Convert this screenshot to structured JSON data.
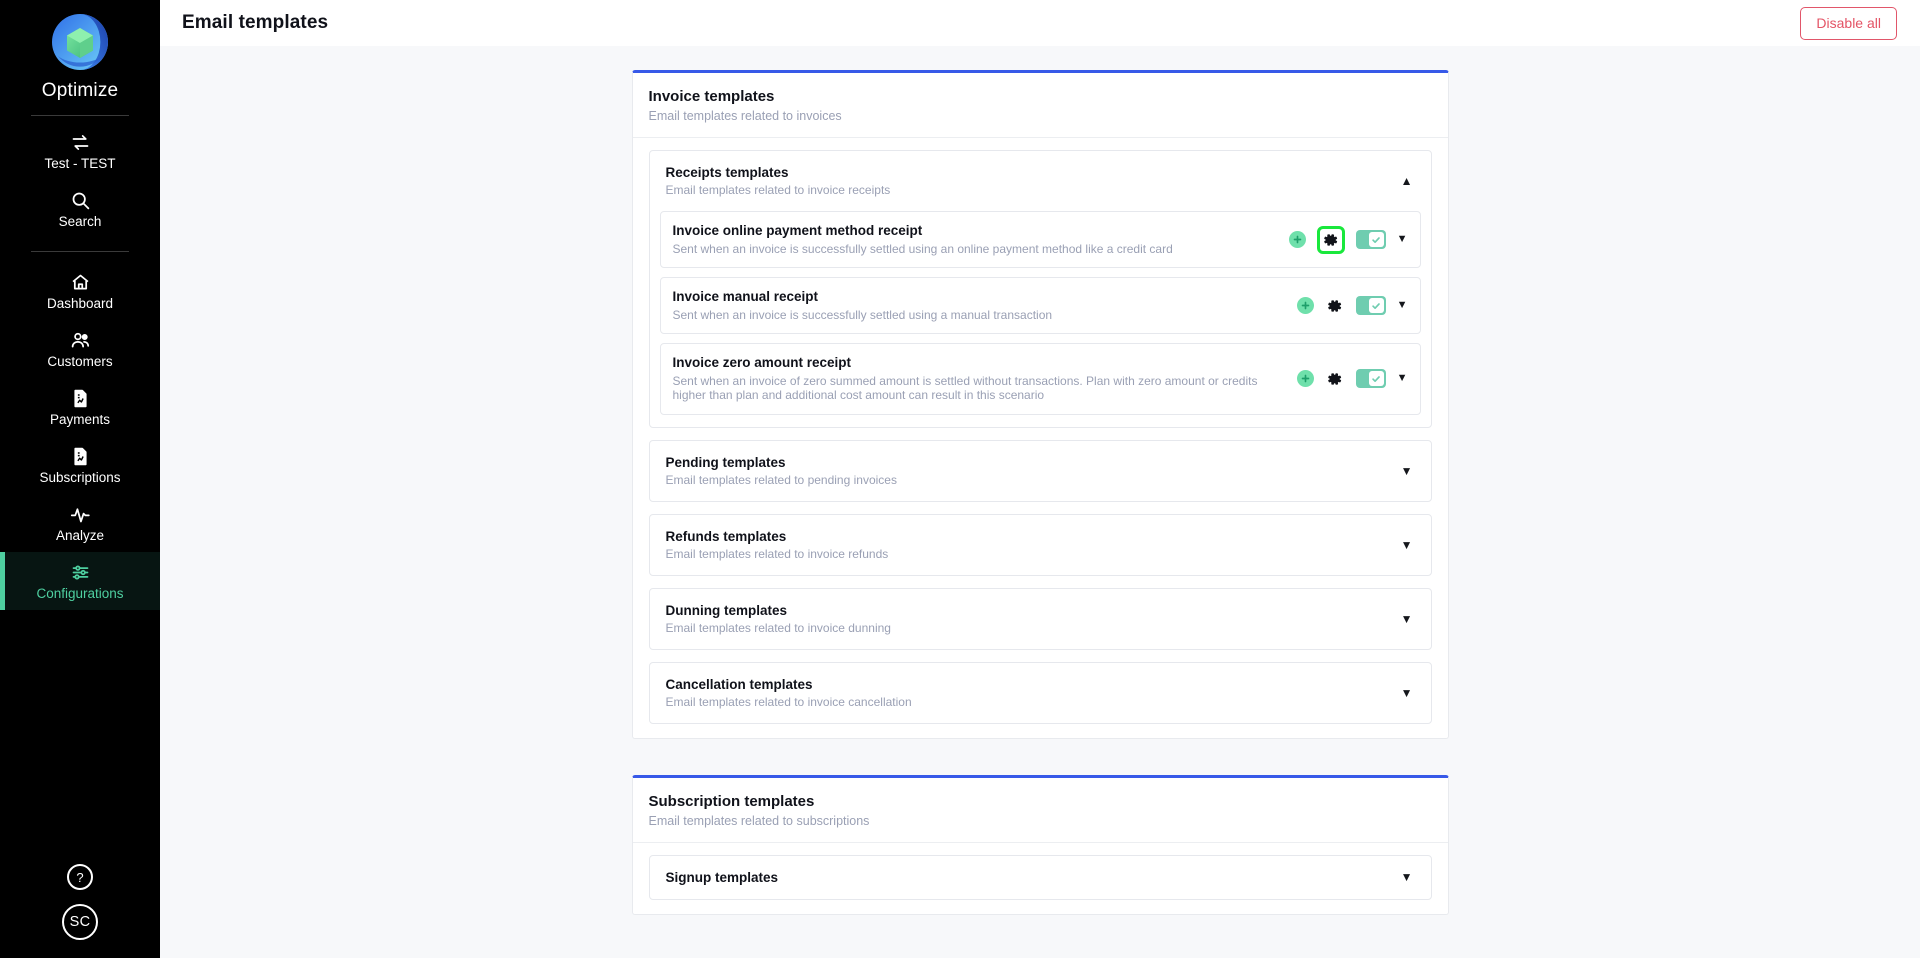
{
  "colors": {
    "sidebar_bg": "#000000",
    "accent_green": "#4ecfa0",
    "card_top_border": "#3759e8",
    "danger": "#e45466",
    "highlight_green": "#19e83c",
    "toggle_on": "#6fcdb0",
    "plus_green": "#6fe0ab"
  },
  "sidebar": {
    "brand": "Optimize",
    "logo_icon": "optimize-logo-icon",
    "top_items": [
      {
        "label": "Test - TEST",
        "icon": "switch-arrows-icon",
        "name": "tenant-switcher",
        "active": false
      },
      {
        "label": "Search",
        "icon": "search-icon",
        "name": "search",
        "active": false
      }
    ],
    "main_items": [
      {
        "label": "Dashboard",
        "icon": "home-icon",
        "name": "dashboard",
        "active": false
      },
      {
        "label": "Customers",
        "icon": "users-icon",
        "name": "customers",
        "active": false
      },
      {
        "label": "Payments",
        "icon": "document-chart-icon",
        "name": "payments",
        "active": false
      },
      {
        "label": "Subscriptions",
        "icon": "document-chart-icon",
        "name": "subscriptions",
        "active": false
      },
      {
        "label": "Analyze",
        "icon": "pulse-icon",
        "name": "analyze",
        "active": false
      },
      {
        "label": "Configurations",
        "icon": "sliders-icon",
        "name": "configurations",
        "active": true
      }
    ],
    "help_label": "?",
    "help_icon": "question-mark-icon",
    "avatar_initials": "SC"
  },
  "header": {
    "title": "Email templates",
    "disable_all_label": "Disable all"
  },
  "cards": [
    {
      "name": "invoice-templates-card",
      "title": "Invoice templates",
      "subtitle": "Email templates related to invoices",
      "sections": [
        {
          "name": "receipts-templates",
          "title": "Receipts templates",
          "subtitle": "Email templates related to invoice receipts",
          "expanded": true,
          "caret": "▲",
          "templates": [
            {
              "name": "invoice-online-payment-method-receipt",
              "title": "Invoice online payment method receipt",
              "description": "Sent when an invoice is successfully settled using an online payment method like a credit card",
              "enabled": true,
              "gear_highlighted": true
            },
            {
              "name": "invoice-manual-receipt",
              "title": "Invoice manual receipt",
              "description": "Sent when an invoice is successfully settled using a manual transaction",
              "enabled": true,
              "gear_highlighted": false
            },
            {
              "name": "invoice-zero-amount-receipt",
              "title": "Invoice zero amount receipt",
              "description": "Sent when an invoice of zero summed amount is settled without transactions. Plan with zero amount or credits higher than plan and additional cost amount can result in this scenario",
              "enabled": true,
              "gear_highlighted": false
            }
          ]
        },
        {
          "name": "pending-templates",
          "title": "Pending templates",
          "subtitle": "Email templates related to pending invoices",
          "expanded": false,
          "caret": "▼",
          "templates": []
        },
        {
          "name": "refunds-templates",
          "title": "Refunds templates",
          "subtitle": "Email templates related to invoice refunds",
          "expanded": false,
          "caret": "▼",
          "templates": []
        },
        {
          "name": "dunning-templates",
          "title": "Dunning templates",
          "subtitle": "Email templates related to invoice dunning",
          "expanded": false,
          "caret": "▼",
          "templates": []
        },
        {
          "name": "cancellation-templates",
          "title": "Cancellation templates",
          "subtitle": "Email templates related to invoice cancellation",
          "expanded": false,
          "caret": "▼",
          "templates": []
        }
      ]
    },
    {
      "name": "subscription-templates-card",
      "title": "Subscription templates",
      "subtitle": "Email templates related to subscriptions",
      "sections": [
        {
          "name": "signup-templates",
          "title": "Signup templates",
          "subtitle": "",
          "expanded": false,
          "caret": "▼",
          "templates": []
        }
      ]
    }
  ]
}
